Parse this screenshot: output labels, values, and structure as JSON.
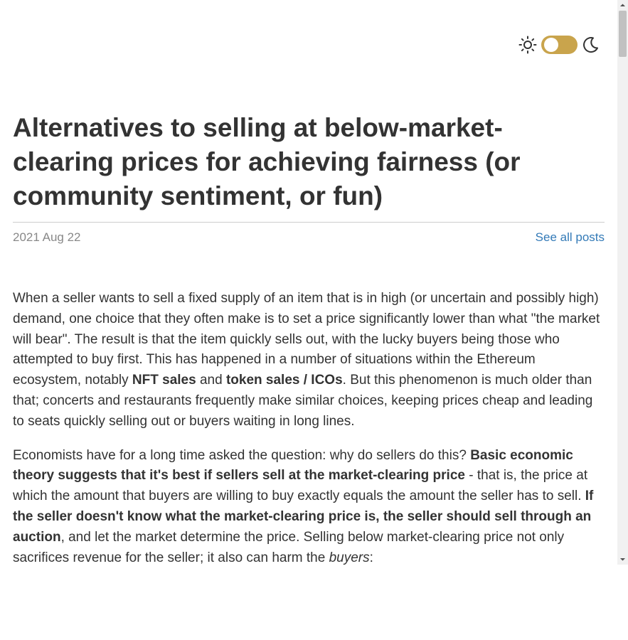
{
  "theme_switch": {
    "mode": "light",
    "accent_color": "#c9a44c",
    "left_icon": "sun-icon",
    "right_icon": "moon-icon"
  },
  "post": {
    "title": "Alternatives to selling at below-market-clearing prices for achieving fairness (or community sentiment, or fun)",
    "date": "2021 Aug 22",
    "see_all_posts": "See all posts"
  },
  "body": {
    "p1": [
      "When a seller wants to sell a fixed supply of an item that is in high (or uncertain and possibly high) demand, one choice that they often make is to set a price significantly lower than what \"the market will bear\". The result is that the item quickly sells out, with the lucky buyers being those who attempted to buy first. This has happened in a number of situations within the Ethereum ecosystem, notably ",
      "NFT sales",
      " and ",
      "token sales / ICOs",
      ". But this phenomenon is much older than that; concerts and restaurants frequently make similar choices, keeping prices cheap and leading to seats quickly selling out or buyers waiting in long lines."
    ],
    "p2": [
      "Economists have for a long time asked the question: why do sellers do this? ",
      "Basic economic theory suggests that it's best if sellers sell at the market-clearing price",
      " - that is, the price at which the amount that buyers are willing to buy exactly equals the amount the seller has to sell. ",
      "If the seller doesn't know what the market-clearing price is, the seller should sell through an auction",
      ", and let the market determine the price. Selling below market-clearing price not only sacrifices revenue for the seller; it also can harm the ",
      "buyers",
      ":"
    ]
  },
  "colors": {
    "text": "#333333",
    "muted": "#888888",
    "link": "#337ab7",
    "accent": "#c9a44c"
  }
}
